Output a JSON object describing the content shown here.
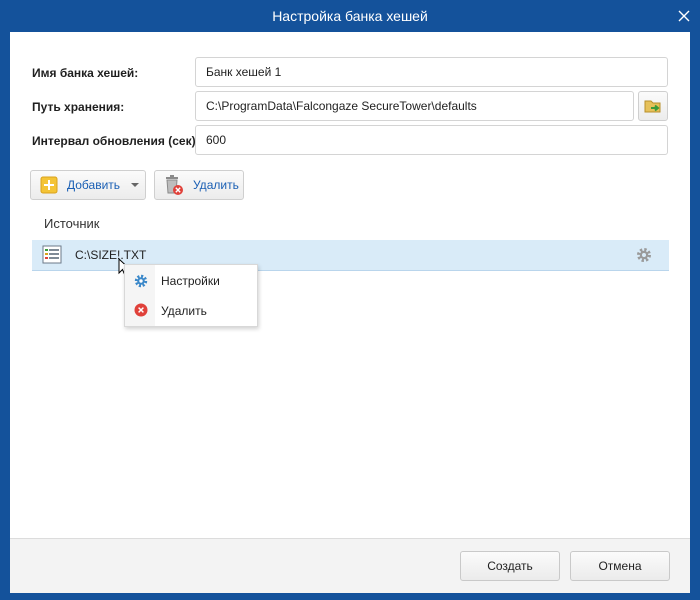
{
  "window": {
    "title": "Настройка банка хешей"
  },
  "form": {
    "name_label": "Имя банка хешей:",
    "name_value": "Банк хешей 1",
    "path_label": "Путь хранения:",
    "path_value": "C:\\ProgramData\\Falcongaze SecureTower\\defaults",
    "interval_label": "Интервал обновления (сек):",
    "interval_value": "600"
  },
  "toolbar": {
    "add_label": "Добавить",
    "delete_label": "Удалить"
  },
  "list": {
    "column_header": "Источник",
    "rows": [
      {
        "name": "C:\\SIZE!.TXT"
      }
    ]
  },
  "context_menu": {
    "items": [
      {
        "label": "Настройки"
      },
      {
        "label": "Удалить"
      }
    ]
  },
  "footer": {
    "create_label": "Создать",
    "cancel_label": "Отмена"
  },
  "colors": {
    "titlebar": "#14529b",
    "selection": "#d9ebf8",
    "link": "#1a5fb4"
  }
}
